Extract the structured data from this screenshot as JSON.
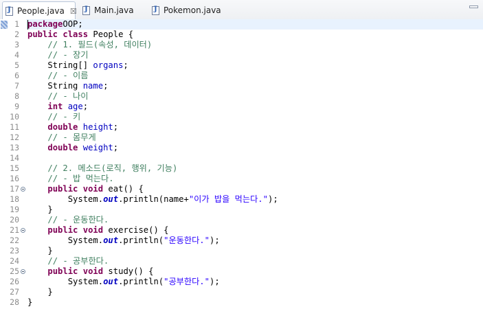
{
  "tabs": [
    {
      "label": "People.java",
      "close": "☒",
      "active": true
    },
    {
      "label": "Main.java",
      "active": false
    },
    {
      "label": "Pokemon.java",
      "active": false
    }
  ],
  "lines": [
    {
      "n": "1",
      "tokens": [
        [
          "kw",
          "package"
        ],
        [
          "",
          "OOP;"
        ]
      ]
    },
    {
      "n": "2",
      "tokens": [
        [
          "kw",
          "public"
        ],
        [
          "",
          " "
        ],
        [
          "kw",
          "class"
        ],
        [
          "",
          " People {"
        ]
      ]
    },
    {
      "n": "3",
      "tokens": [
        [
          "",
          "    "
        ],
        [
          "cm",
          "// 1. 필드(속성, 데이터)"
        ]
      ]
    },
    {
      "n": "4",
      "tokens": [
        [
          "",
          "    "
        ],
        [
          "cm",
          "// - 장기"
        ]
      ]
    },
    {
      "n": "5",
      "tokens": [
        [
          "",
          "    String[] "
        ],
        [
          "fd",
          "organs"
        ],
        [
          "",
          ";"
        ]
      ]
    },
    {
      "n": "6",
      "tokens": [
        [
          "",
          "    "
        ],
        [
          "cm",
          "// - 이름"
        ]
      ]
    },
    {
      "n": "7",
      "tokens": [
        [
          "",
          "    String "
        ],
        [
          "fd",
          "name"
        ],
        [
          "",
          ";"
        ]
      ]
    },
    {
      "n": "8",
      "tokens": [
        [
          "",
          "    "
        ],
        [
          "cm",
          "// - 나이"
        ]
      ]
    },
    {
      "n": "9",
      "tokens": [
        [
          "",
          "    "
        ],
        [
          "kw",
          "int"
        ],
        [
          "",
          " "
        ],
        [
          "fd",
          "age"
        ],
        [
          "",
          ";"
        ]
      ]
    },
    {
      "n": "10",
      "tokens": [
        [
          "",
          "    "
        ],
        [
          "cm",
          "// - 키"
        ]
      ]
    },
    {
      "n": "11",
      "tokens": [
        [
          "",
          "    "
        ],
        [
          "kw",
          "double"
        ],
        [
          "",
          " "
        ],
        [
          "fd",
          "height"
        ],
        [
          "",
          ";"
        ]
      ]
    },
    {
      "n": "12",
      "tokens": [
        [
          "",
          "    "
        ],
        [
          "cm",
          "// - 몸무게"
        ]
      ]
    },
    {
      "n": "13",
      "tokens": [
        [
          "",
          "    "
        ],
        [
          "kw",
          "double"
        ],
        [
          "",
          " "
        ],
        [
          "fd",
          "weight"
        ],
        [
          "",
          ";"
        ]
      ]
    },
    {
      "n": "14",
      "tokens": [
        [
          "",
          ""
        ]
      ]
    },
    {
      "n": "15",
      "tokens": [
        [
          "",
          "    "
        ],
        [
          "cm",
          "// 2. 메소드(로직, 행위, 기능)"
        ]
      ]
    },
    {
      "n": "16",
      "tokens": [
        [
          "",
          "    "
        ],
        [
          "cm",
          "// - 밥 먹는다."
        ]
      ]
    },
    {
      "n": "17",
      "fold": true,
      "tokens": [
        [
          "",
          "    "
        ],
        [
          "kw",
          "public"
        ],
        [
          "",
          " "
        ],
        [
          "kw",
          "void"
        ],
        [
          "",
          " eat() {"
        ]
      ]
    },
    {
      "n": "18",
      "tokens": [
        [
          "",
          "        System."
        ],
        [
          "sf",
          "out"
        ],
        [
          "",
          ".println(name+"
        ],
        [
          "st",
          "\"이가 밥을 먹는다.\""
        ],
        [
          "",
          ");"
        ]
      ]
    },
    {
      "n": "19",
      "tokens": [
        [
          "",
          "    }"
        ]
      ]
    },
    {
      "n": "20",
      "tokens": [
        [
          "",
          "    "
        ],
        [
          "cm",
          "// - 운동한다."
        ]
      ]
    },
    {
      "n": "21",
      "fold": true,
      "tokens": [
        [
          "",
          "    "
        ],
        [
          "kw",
          "public"
        ],
        [
          "",
          " "
        ],
        [
          "kw",
          "void"
        ],
        [
          "",
          " exercise() {"
        ]
      ]
    },
    {
      "n": "22",
      "tokens": [
        [
          "",
          "        System."
        ],
        [
          "sf",
          "out"
        ],
        [
          "",
          ".println("
        ],
        [
          "st",
          "\"운동한다.\""
        ],
        [
          "",
          ");"
        ]
      ]
    },
    {
      "n": "23",
      "tokens": [
        [
          "",
          "    }"
        ]
      ]
    },
    {
      "n": "24",
      "tokens": [
        [
          "",
          "    "
        ],
        [
          "cm",
          "// - 공부한다."
        ]
      ]
    },
    {
      "n": "25",
      "fold": true,
      "tokens": [
        [
          "",
          "    "
        ],
        [
          "kw",
          "public"
        ],
        [
          "",
          " "
        ],
        [
          "kw",
          "void"
        ],
        [
          "",
          " study() {"
        ]
      ]
    },
    {
      "n": "26",
      "tokens": [
        [
          "",
          "        System."
        ],
        [
          "sf",
          "out"
        ],
        [
          "",
          ".println("
        ],
        [
          "st",
          "\"공부한다.\""
        ],
        [
          "",
          ");"
        ]
      ]
    },
    {
      "n": "27",
      "tokens": [
        [
          "",
          "    }"
        ]
      ]
    },
    {
      "n": "28",
      "tokens": [
        [
          "",
          "}"
        ]
      ]
    }
  ]
}
